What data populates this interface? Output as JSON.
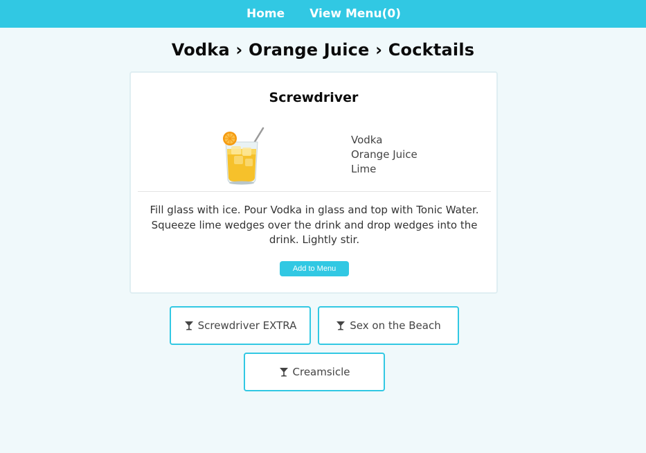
{
  "nav": {
    "home_label": "Home",
    "view_menu_label": "View Menu(0)"
  },
  "breadcrumb_title": "Vodka › Orange Juice › Cocktails",
  "drink": {
    "name": "Screwdriver",
    "image_icon": "cocktail-glass-orange-icon",
    "ingredients": [
      "Vodka",
      "Orange Juice",
      "Lime"
    ],
    "instructions": "Fill glass with ice. Pour Vodka in glass and top with Tonic Water. Squeeze lime wedges over the drink and drop wedges into the drink. Lightly stir.",
    "add_button_label": "Add to Menu"
  },
  "related_drinks": [
    {
      "label": "Screwdriver EXTRA",
      "icon": "martini-glass-icon"
    },
    {
      "label": "Sex on the Beach",
      "icon": "martini-glass-icon"
    },
    {
      "label": "Creamsicle",
      "icon": "martini-glass-icon"
    }
  ],
  "colors": {
    "accent": "#31c8e3",
    "background": "#f0f9fb",
    "card": "#ffffff"
  }
}
